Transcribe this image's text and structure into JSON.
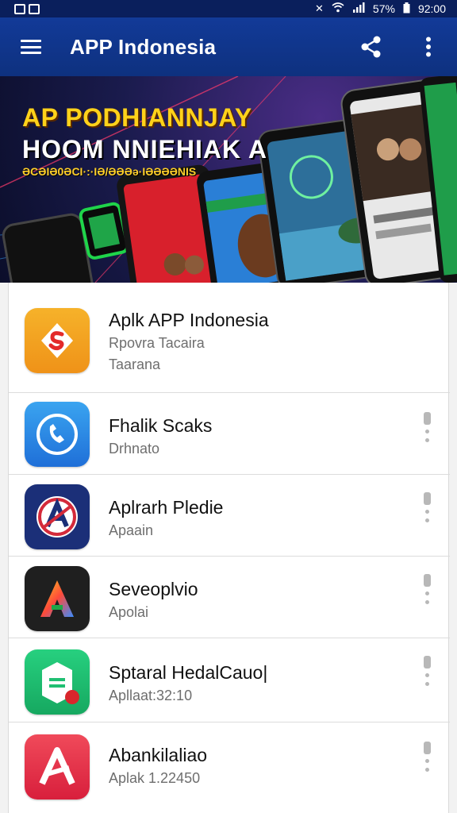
{
  "status_bar": {
    "battery": "57%",
    "time": "92:00"
  },
  "app_bar": {
    "title": "APP Indonesia",
    "icons": [
      "menu-icon",
      "share-icon",
      "more-vert-icon"
    ]
  },
  "banner": {
    "title_line_1": "AP PODHIANNJAY",
    "title_line_2": "HOOM NNIEHIAK A",
    "subtitle": "ƏCƏIƏ0ƏCI·:·IƏ/ƏƏƏə·IƏƏƏƏNIS"
  },
  "apps": [
    {
      "name": "Aplk APP Indonesia",
      "line1": "Rpovra Tacaira",
      "line2": "Taarana",
      "icon": "shield-s-icon",
      "color": "#f3a21f",
      "has_menu": false
    },
    {
      "name": "Fhalik Scaks",
      "line1": "Drhnato",
      "icon": "phone-circle-icon",
      "color": "#2b8fe6",
      "has_menu": true
    },
    {
      "name": "Aplrarh Pledie",
      "line1": "Apaain",
      "icon": "a-badge-icon",
      "color": "#1b2f78",
      "has_menu": true
    },
    {
      "name": "Seveoplvio",
      "line1": "Apolai",
      "icon": "gradient-a-icon",
      "color": "#1f1f1f",
      "has_menu": true
    },
    {
      "name": "Sptaral HedalCauo|",
      "line1": "Apllaat:32:10",
      "icon": "tag-icon",
      "color": "#1fbf72",
      "has_menu": true
    },
    {
      "name": "Abankilaliao",
      "line1": "Aplak 1.22450",
      "icon": "letter-a-icon",
      "color": "#e3304a",
      "has_menu": true
    }
  ]
}
